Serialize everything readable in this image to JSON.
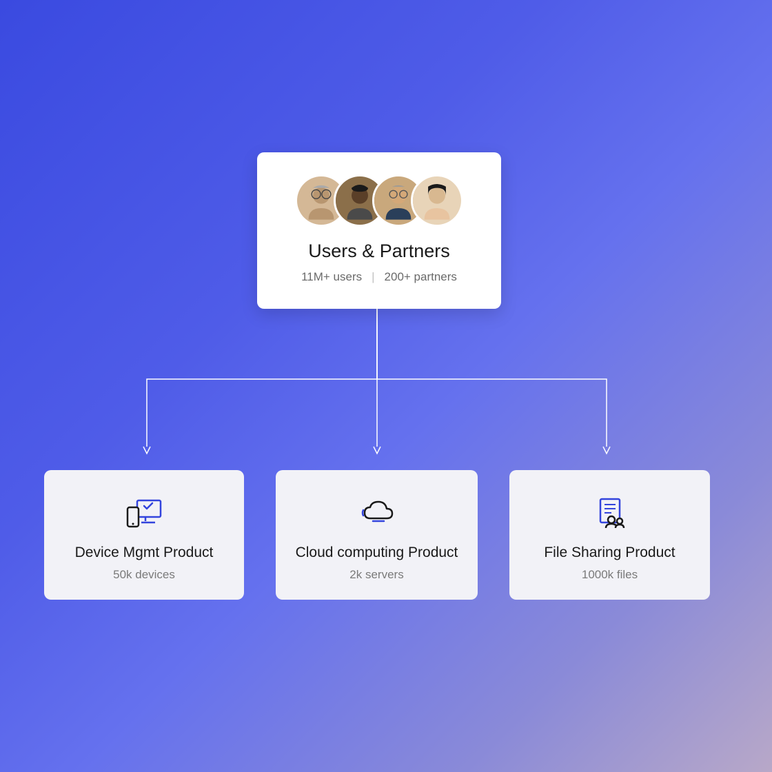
{
  "root": {
    "title": "Users & Partners",
    "stat_users": "11M+ users",
    "stat_partners": "200+ partners",
    "avatars": [
      {
        "bg": "#d4b896"
      },
      {
        "bg": "#8b6f4a"
      },
      {
        "bg": "#c9a87c"
      },
      {
        "bg": "#e8d4b8"
      }
    ]
  },
  "children": [
    {
      "title": "Device Mgmt Product",
      "stat": "50k devices",
      "icon": "devices"
    },
    {
      "title": "Cloud computing Product",
      "stat": "2k servers",
      "icon": "cloud"
    },
    {
      "title": "File Sharing Product",
      "stat": "1000k files",
      "icon": "file-share"
    }
  ]
}
